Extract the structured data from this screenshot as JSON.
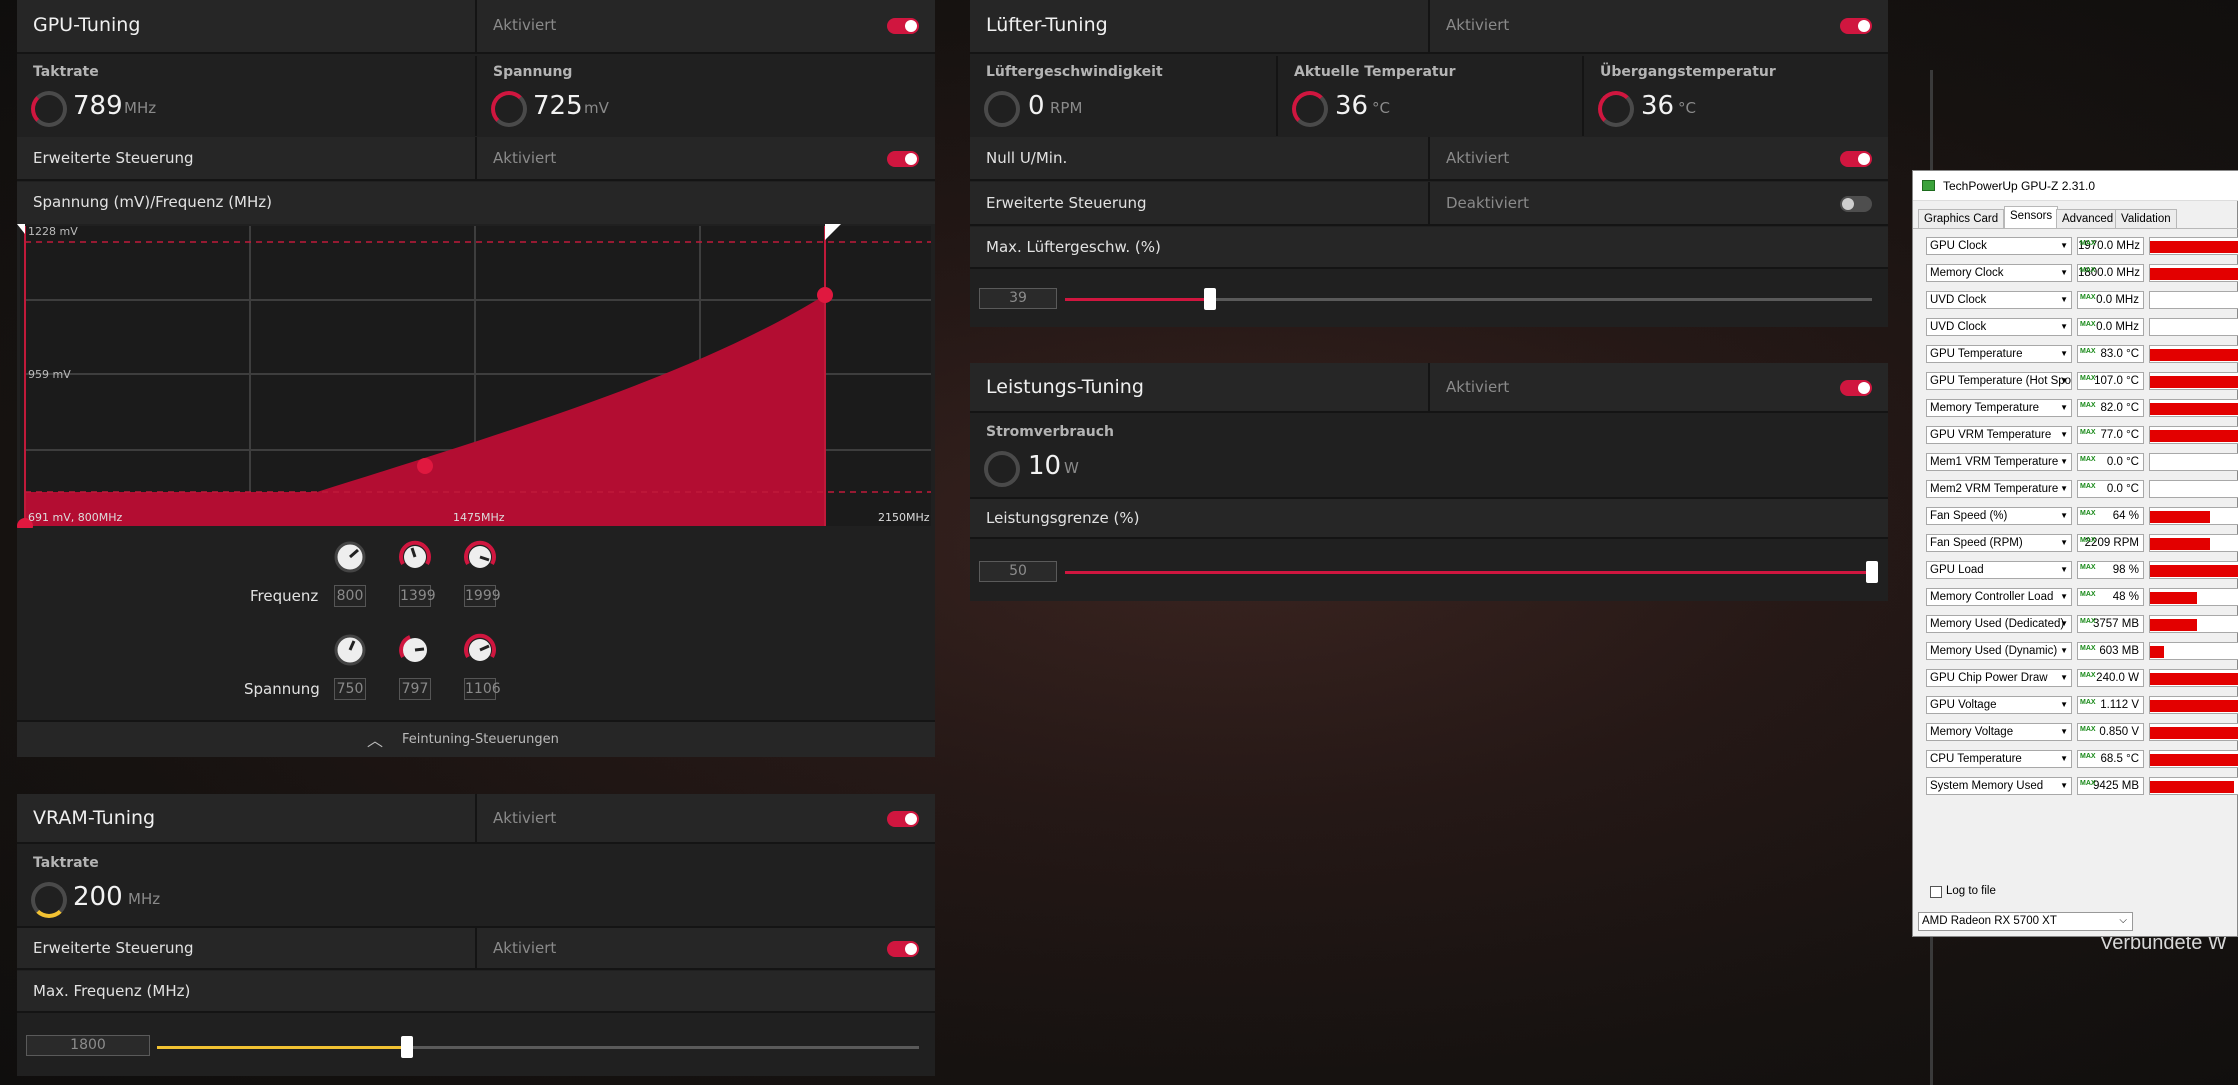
{
  "gpu_tuning": {
    "title": "GPU-Tuning",
    "status": "Aktiviert",
    "enabled": true,
    "clock_label": "Taktrate",
    "clock_value": "789",
    "clock_unit": "MHz",
    "voltage_label": "Spannung",
    "voltage_value": "725",
    "voltage_unit": "mV",
    "advanced_label": "Erweiterte Steuerung",
    "advanced_status": "Aktiviert",
    "advanced_enabled": true,
    "curve_label": "Spannung (mV)/Frequenz (MHz)",
    "curve": {
      "y_top_label": "1228 mV",
      "y_mid_label": "959 mV",
      "x_start_label": "691 mV, 800MHz",
      "x_mid_label": "1475MHz",
      "x_end_label": "2150MHz"
    },
    "freq_label": "Frequenz",
    "freq_values": [
      "800",
      "1399",
      "1999"
    ],
    "volt_label": "Spannung",
    "volt_values": [
      "750",
      "797",
      "1106"
    ],
    "fine_tuning_label": "Feintuning-Steuerungen"
  },
  "vram_tuning": {
    "title": "VRAM-Tuning",
    "status": "Aktiviert",
    "enabled": true,
    "clock_label": "Taktrate",
    "clock_value": "200",
    "clock_unit": "MHz",
    "advanced_label": "Erweiterte Steuerung",
    "advanced_status": "Aktiviert",
    "advanced_enabled": true,
    "max_freq_label": "Max. Frequenz (MHz)",
    "max_freq_value": "1800",
    "max_freq_fraction": 0.33
  },
  "fan_tuning": {
    "title": "Lüfter-Tuning",
    "status": "Aktiviert",
    "enabled": true,
    "fan_speed_label": "Lüftergeschwindigkeit",
    "fan_speed_value": "0",
    "fan_speed_unit": "RPM",
    "temp_label": "Aktuelle Temperatur",
    "temp_value": "36",
    "temp_unit": "°C",
    "junction_label": "Übergangstemperatur",
    "junction_value": "36",
    "junction_unit": "°C",
    "zero_rpm_label": "Null U/Min.",
    "zero_rpm_status": "Aktiviert",
    "zero_rpm_enabled": true,
    "advanced_label": "Erweiterte Steuerung",
    "advanced_status": "Deaktiviert",
    "advanced_enabled": false,
    "max_fan_label": "Max. Lüftergeschw. (%)",
    "max_fan_value": "39",
    "max_fan_fraction": 0.18
  },
  "power_tuning": {
    "title": "Leistungs-Tuning",
    "status": "Aktiviert",
    "enabled": true,
    "power_label": "Stromverbrauch",
    "power_value": "10",
    "power_unit": "W",
    "limit_label": "Leistungsgrenze (%)",
    "limit_value": "50",
    "limit_fraction": 1.0
  },
  "gpuz": {
    "title": "TechPowerUp GPU-Z 2.31.0",
    "tabs": [
      "Graphics Card",
      "Sensors",
      "Advanced",
      "Validation"
    ],
    "active_tab": "Sensors",
    "sensors": [
      {
        "name": "GPU Clock",
        "value": "1970.0 MHz",
        "level": 0.95
      },
      {
        "name": "Memory Clock",
        "value": "1800.0 MHz",
        "level": 0.95
      },
      {
        "name": "UVD Clock",
        "value": "0.0 MHz",
        "level": 0
      },
      {
        "name": "UVD Clock",
        "value": "0.0 MHz",
        "level": 0
      },
      {
        "name": "GPU Temperature",
        "value": "83.0 °C",
        "level": 0.95
      },
      {
        "name": "GPU Temperature (Hot Spot)",
        "value": "107.0 °C",
        "level": 0.95
      },
      {
        "name": "Memory Temperature",
        "value": "82.0 °C",
        "level": 0.95
      },
      {
        "name": "GPU VRM Temperature",
        "value": "77.0 °C",
        "level": 0.95
      },
      {
        "name": "Mem1 VRM Temperature",
        "value": "0.0 °C",
        "level": 0
      },
      {
        "name": "Mem2 VRM Temperature",
        "value": "0.0 °C",
        "level": 0
      },
      {
        "name": "Fan Speed (%)",
        "value": "64 %",
        "level": 0.65
      },
      {
        "name": "Fan Speed (RPM)",
        "value": "2209 RPM",
        "level": 0.65
      },
      {
        "name": "GPU Load",
        "value": "98 %",
        "level": 0.95
      },
      {
        "name": "Memory Controller Load",
        "value": "48 %",
        "level": 0.5
      },
      {
        "name": "Memory Used (Dedicated)",
        "value": "3757 MB",
        "level": 0.5
      },
      {
        "name": "Memory Used (Dynamic)",
        "value": "603 MB",
        "level": 0.15
      },
      {
        "name": "GPU Chip Power Draw",
        "value": "240.0 W",
        "level": 0.95
      },
      {
        "name": "GPU Voltage",
        "value": "1.112 V",
        "level": 0.95
      },
      {
        "name": "Memory Voltage",
        "value": "0.850 V",
        "level": 0.95
      },
      {
        "name": "CPU Temperature",
        "value": "68.5 °C",
        "level": 0.95
      },
      {
        "name": "System Memory Used",
        "value": "9425 MB",
        "level": 0.9
      }
    ],
    "log_label": "Log to file",
    "device": "AMD Radeon RX 5700 XT",
    "behind_text": "Verbundete W"
  },
  "colors": {
    "accent": "#d0163f",
    "vram_accent": "#f2c232",
    "gpuz_bar": "#e30000"
  }
}
